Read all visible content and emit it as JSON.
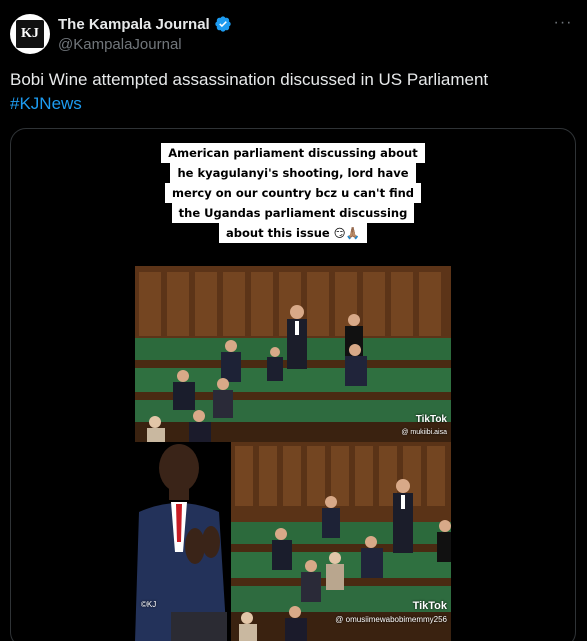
{
  "account": {
    "display_name": "The Kampala Journal",
    "handle": "@KampalaJournal",
    "avatar_text": "KJ",
    "verified": true
  },
  "tweet": {
    "text": "Bobi Wine attempted assassination discussed in US Parliament",
    "hashtag": "#KJNews"
  },
  "media": {
    "caption_lines": [
      "American parliament discussing about",
      "he kyagulanyi's shooting, lord have",
      "mercy on our country bcz u can't find",
      "the Ugandas parliament discussing",
      "about this issue 😏🙏🏽"
    ],
    "tiktok_top": "TikTok",
    "tiktok_top_user": "@ mukiibi.aisa",
    "tiktok_bottom": "TikTok",
    "tiktok_bottom_user": "@ omusiimewabobimemmy256",
    "inset_credit": "©KJ"
  },
  "colors": {
    "accent": "#1d9bf0",
    "bench_green": "#2e6b3f",
    "wood": "#6b3a1c"
  }
}
